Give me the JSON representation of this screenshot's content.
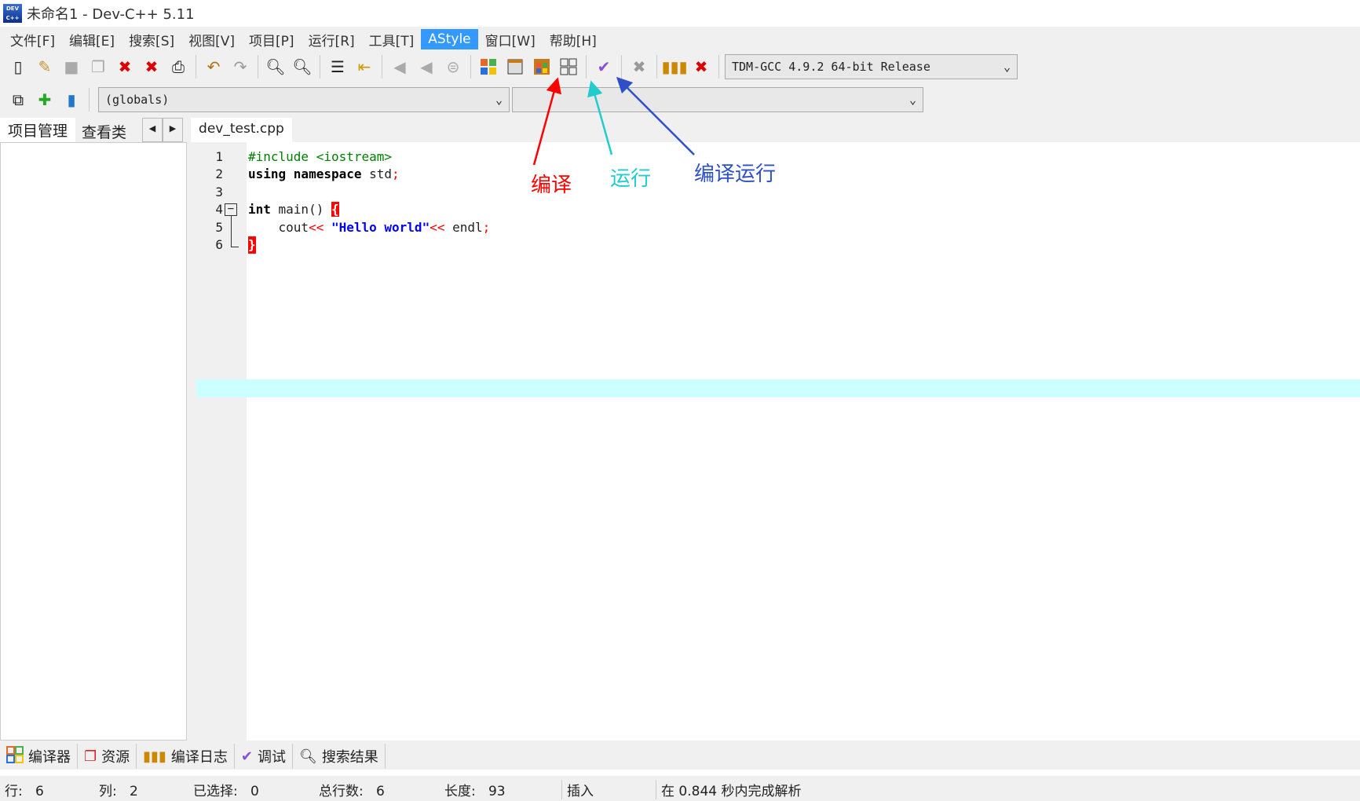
{
  "window": {
    "title": "未命名1 - Dev-C++ 5.11",
    "icon_label": "DEV C++"
  },
  "menu": [
    {
      "label": "文件[F]"
    },
    {
      "label": "编辑[E]"
    },
    {
      "label": "搜索[S]"
    },
    {
      "label": "视图[V]"
    },
    {
      "label": "项目[P]"
    },
    {
      "label": "运行[R]"
    },
    {
      "label": "工具[T]"
    },
    {
      "label": "AStyle"
    },
    {
      "label": "窗口[W]"
    },
    {
      "label": "帮助[H]"
    }
  ],
  "toolbar": {
    "compiler_select": "TDM-GCC 4.9.2 64-bit Release",
    "scope_select": "(globals)",
    "member_select": ""
  },
  "left_tabs": [
    "项目管理",
    "查看类"
  ],
  "file_tab": "dev_test.cpp",
  "code_lines": [
    {
      "n": "1"
    },
    {
      "n": "2"
    },
    {
      "n": "3"
    },
    {
      "n": "4"
    },
    {
      "n": "5"
    },
    {
      "n": "6"
    }
  ],
  "code": {
    "l1": "#include <iostream>",
    "l2a": "using namespace ",
    "l2b": "std",
    "l2c": ";",
    "l4a": "int ",
    "l4b": "main() ",
    "l4c": "{",
    "l5a": "    cout",
    "l5b": "<< ",
    "l5c": "\"Hello world\"",
    "l5d": "<< ",
    "l5e": "endl",
    "l5f": ";",
    "l6": "}"
  },
  "annotations": {
    "compile": "编译",
    "run": "运行",
    "compile_run": "编译运行",
    "colors": {
      "compile": "#ff0000",
      "run": "#22cccc",
      "compile_run": "#2f4fc9"
    }
  },
  "bottom_tabs": [
    "编译器",
    "资源",
    "编译日志",
    "调试",
    "搜索结果"
  ],
  "status": {
    "row_label": "行:",
    "row": "6",
    "col_label": "列:",
    "col": "2",
    "sel_label": "已选择:",
    "sel": "0",
    "total_label": "总行数:",
    "total": "6",
    "len_label": "长度:",
    "len": "93",
    "mode": "插入",
    "parse": "在 0.844 秒内完成解析"
  }
}
